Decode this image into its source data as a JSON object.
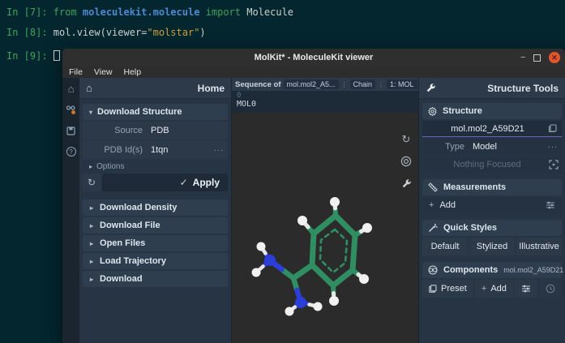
{
  "terminal": {
    "line1": {
      "prompt": "In [7]: ",
      "kw_from": "from ",
      "module": "moleculekit.molecule",
      "kw_import": " import ",
      "rest": "Molecule"
    },
    "line2": {
      "prompt": "In [8]: ",
      "code": "mol.view(viewer=",
      "string": "\"molstar\"",
      "close": ")"
    },
    "line3": {
      "prompt": "In [9]: "
    }
  },
  "window": {
    "title": "MolKit* - MoleculeKit viewer",
    "controls": {
      "minimize": "–",
      "close": "✕"
    }
  },
  "menu": {
    "items": [
      {
        "label": "File"
      },
      {
        "label": "View"
      },
      {
        "label": "Help"
      }
    ]
  },
  "icons": {
    "home": "⌂",
    "help": "?",
    "caret_down": "▾",
    "caret_right": "▸",
    "check": "✓",
    "plus": "+",
    "ellipsis": "···",
    "refresh": "↻",
    "dots_vertical": "⋮",
    "question": "?"
  },
  "sidebar": {
    "header": "Home",
    "download_structure": {
      "title": "Download Structure",
      "source_label": "Source",
      "source_value": "PDB",
      "pdbid_label": "PDB Id(s)",
      "pdbid_value": "1tqn",
      "options_label": "Options",
      "apply_label": "Apply"
    },
    "collapsed_sections": [
      {
        "label": "Download Density"
      },
      {
        "label": "Download File"
      },
      {
        "label": "Open Files"
      },
      {
        "label": "Load Trajectory"
      },
      {
        "label": "Download"
      }
    ]
  },
  "sequence": {
    "label": "Sequence of",
    "entity": "mol.mol2_A5...",
    "chain_label": "Chain",
    "chain_value": "1: MOL",
    "row_index": "0",
    "row_name": "MOL0"
  },
  "right_panel": {
    "header": "Structure Tools",
    "structure": {
      "title": "Structure",
      "entry": "mol.mol2_A59D21",
      "type_label": "Type",
      "type_value": "Model",
      "focus_placeholder": "Nothing Focused"
    },
    "measurements": {
      "title": "Measurements",
      "add_label": "Add"
    },
    "quick_styles": {
      "title": "Quick Styles",
      "buttons": [
        {
          "label": "Default"
        },
        {
          "label": "Stylized"
        },
        {
          "label": "Illustrative"
        }
      ]
    },
    "components": {
      "title": "Components",
      "entry": "mol.mol2_A59D21",
      "preset_label": "Preset",
      "add_label": "Add"
    }
  },
  "colors": {
    "terminal_bg": "#04262e",
    "panel_bg": "#263443",
    "accent_purple": "#6b5fc0",
    "close_button": "#e0572f",
    "atom_carbon": "#2f8f63",
    "atom_nitrogen": "#2b3fd8",
    "atom_hydrogen": "#f1f1f1"
  }
}
